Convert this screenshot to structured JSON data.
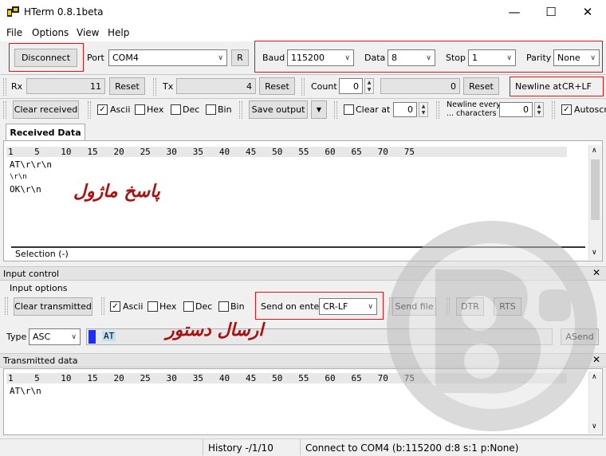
{
  "window": {
    "title": "HTerm 0.8.1beta",
    "minimize": "—",
    "maximize": "☐",
    "close": "✕"
  },
  "menu": [
    "File",
    "Options",
    "View",
    "Help"
  ],
  "connection": {
    "disconnect_label": "Disconnect",
    "port_label": "Port",
    "port_value": "COM4",
    "refresh_label": "R",
    "baud_label": "Baud",
    "baud_value": "115200",
    "data_label": "Data",
    "data_value": "8",
    "stop_label": "Stop",
    "stop_value": "1",
    "parity_label": "Parity",
    "parity_value": "None"
  },
  "counters": {
    "rx_label": "Rx",
    "rx_value": "11",
    "rx_reset": "Reset",
    "tx_label": "Tx",
    "tx_value": "4",
    "tx_reset": "Reset",
    "count_label": "Count",
    "count_value": "0",
    "count_total": "0",
    "count_reset": "Reset",
    "newline_label": "Newline at",
    "newline_value": "CR+LF"
  },
  "receive_options": {
    "clear_label": "Clear received",
    "ascii": "Ascii",
    "hex": "Hex",
    "dec": "Dec",
    "bin": "Bin",
    "save_label": "Save output",
    "clear_at_label": "Clear at",
    "clear_at_value": "0",
    "newline_every_1": "Newline every",
    "newline_every_2": "... characters",
    "newline_every_value": "0",
    "autoscroll": "Autoscro"
  },
  "received": {
    "tab_label": "Received Data",
    "ruler": "1    5    10   15   20   25   30   35   40   45   50   55   60   65   70   75",
    "lines": [
      "AT\\r\\r\\n",
      "\\r\\n",
      "OK\\r\\n"
    ],
    "annotation": "پاسخ ماژول",
    "selection": "Selection (-)"
  },
  "input_control": {
    "header": "Input control",
    "close": "✕",
    "options_label": "Input options",
    "clear_label": "Clear transmitted",
    "ascii": "Ascii",
    "hex": "Hex",
    "dec": "Dec",
    "bin": "Bin",
    "send_on_enter_label": "Send on enter",
    "send_on_enter_value": "CR-LF",
    "send_file": "Send file",
    "dtr": "DTR",
    "rts": "RTS",
    "type_label": "Type",
    "type_value": "ASC",
    "input_value": "AT",
    "annotation": "ارسال دستور",
    "asend": "ASend"
  },
  "transmitted": {
    "header": "Transmitted data",
    "close": "✕",
    "ruler": "1    5    10   15   20   25   30   35   40   45   50   55   60   65   70   75",
    "lines": [
      "AT\\r\\n"
    ]
  },
  "status": {
    "history": "History -/1/10",
    "connection": "Connect to COM4 (b:115200 d:8 s:1 p:None)"
  },
  "colors": {
    "highlight_red": "#dd1111",
    "annotation_red": "#aa1111",
    "cursor_blue": "#1a2cff"
  }
}
